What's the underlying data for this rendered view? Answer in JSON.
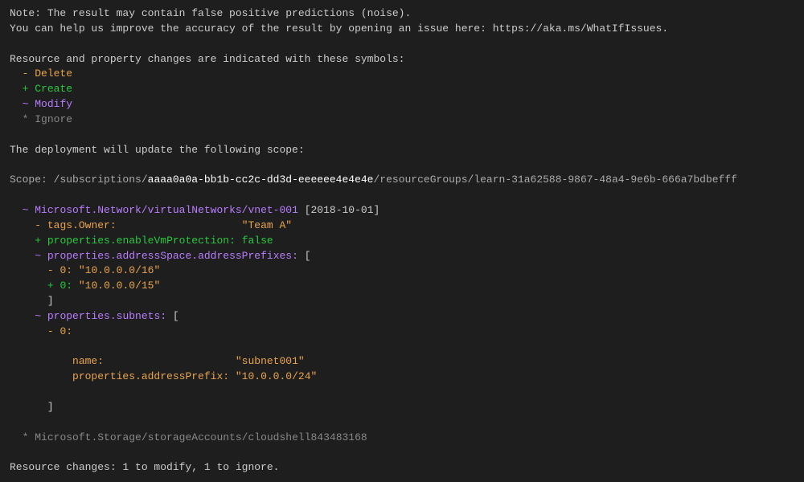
{
  "note_line1": "Note: The result may contain false positive predictions (noise).",
  "note_line2": "You can help us improve the accuracy of the result by opening an issue here: https://aka.ms/WhatIfIssues.",
  "legend_header": "Resource and property changes are indicated with these symbols:",
  "legend": {
    "delete": {
      "sym": "-",
      "label": "Delete"
    },
    "create": {
      "sym": "+",
      "label": "Create"
    },
    "modify": {
      "sym": "~",
      "label": "Modify"
    },
    "ignore": {
      "sym": "*",
      "label": "Ignore"
    }
  },
  "deploy_header": "The deployment will update the following scope:",
  "scope": {
    "prefix": "Scope: /subscriptions/",
    "sub_id": "aaaa0a0a-bb1b-cc2c-dd3d-eeeeee4e4e4e",
    "suffix": "/resourceGroups/learn-31a62588-9867-48a4-9e6b-666a7bdbefff"
  },
  "res_modify": {
    "sym": "~",
    "name": "Microsoft.Network/virtualNetworks/vnet-001",
    "api": "[2018-10-01]"
  },
  "prop_tags_owner": {
    "sym": "-",
    "key": "tags.Owner:",
    "val": "\"Team A\""
  },
  "prop_enable_vm": {
    "sym": "+",
    "key": "properties.enableVmProtection:",
    "val": "false"
  },
  "prop_addr_prefixes": {
    "sym": "~",
    "key": "properties.addressSpace.addressPrefixes:",
    "open": "[",
    "old": {
      "sym": "-",
      "idx": "0:",
      "val": "\"10.0.0.0/16\""
    },
    "new": {
      "sym": "+",
      "idx": "0:",
      "val": "\"10.0.0.0/15\""
    },
    "close": "]"
  },
  "prop_subnets": {
    "sym": "~",
    "key": "properties.subnets:",
    "open": "[",
    "item_sym": "-",
    "item_idx": "0:",
    "name_key": "name:",
    "name_val": "\"subnet001\"",
    "addr_key": "properties.addressPrefix:",
    "addr_val": "\"10.0.0.0/24\"",
    "close": "]"
  },
  "res_ignore": {
    "sym": "*",
    "name": "Microsoft.Storage/storageAccounts/cloudshell843483168"
  },
  "summary": "Resource changes: 1 to modify, 1 to ignore."
}
